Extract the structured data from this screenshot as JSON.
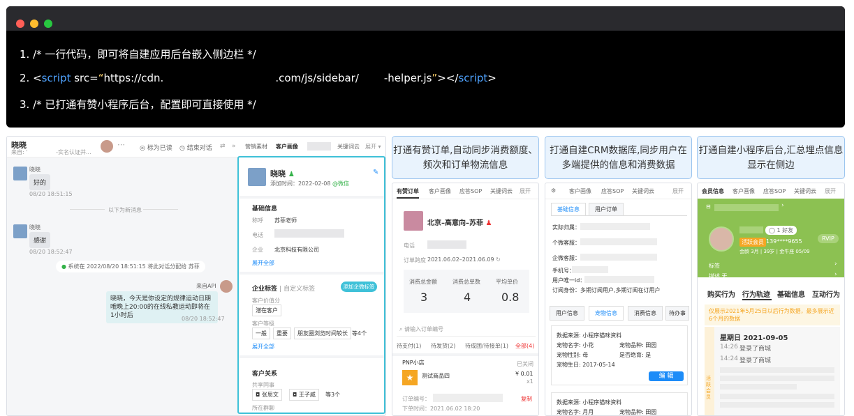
{
  "code": {
    "line1": "1. /* 一行代码，即可将自建应用后台嵌入侧边栏 */",
    "line2_prefix": "2. <",
    "line2_kw": "script",
    "line2_src": " src=",
    "line2_q1": "“",
    "line2_url1": "https://cdn.",
    "line2_url2": ".com/js/sidebar/",
    "line2_url3": "-helper.js",
    "line2_q2": "”",
    "line2_mid": "></",
    "line2_kw2": "script",
    "line2_end": ">",
    "line3": "3. /* 已打通有赞小程序后台，配置即可直接使用 */"
  },
  "chat": {
    "contact_name": "晓晓",
    "contact_sub": "来自: '                -实名认证并...",
    "mark_read": "标为已读",
    "end_chat": "结束对话",
    "msg1_name": "晓晓",
    "msg1_text": "好的",
    "msg1_time": "08/20 18:51:15",
    "divider": "以下为新消息",
    "msg2_name": "晓晓",
    "msg2_text": "感谢",
    "msg2_time": "08/20 18:52:47",
    "system": "系统在 2022/08/20 18:51:15 将此对话分配给 苏菲",
    "api_label": "来自API",
    "api_text": "晓晓，今天是你设定的规律运动日期哦晚上20:00的在线私教运动即将在1小时后",
    "api_time": "08/20 18:52:47"
  },
  "sidebar1": {
    "tabs": [
      "营销素材",
      "客户画像",
      "关键词云",
      "展开"
    ],
    "name": "晓晓",
    "added": "添加时间：2022-02-08",
    "wechat": "@微信",
    "basic_title": "基础信息",
    "nick_label": "称呼",
    "nick_value": "苏菲老师",
    "phone_label": "电话",
    "company_label": "企业",
    "company_value": "北京科技有限公司",
    "expand_all": "展开全部",
    "tags_title": "企业标签",
    "custom_tags": "自定义标签",
    "add_tag": "添加企微标签",
    "value_label": "客户价值分",
    "value_tag": "潜在客户",
    "level_label": "客户等级",
    "level_tags": [
      "一般",
      "重要",
      "朋友圈浏览时间较长"
    ],
    "level_more": "等4个",
    "expand_all2": "展开全部",
    "relation_title": "客户关系",
    "share_label": "共享同事",
    "share_people": [
      "张思文",
      "王子威"
    ],
    "share_more": "等3个",
    "group_label": "所在群聊"
  },
  "captions": [
    "打通有赞订单,自动同步消费额度、频次和订单物流信息",
    "打通自建CRM数据库,同步用户在多端提供的信息和消费数据",
    "打通自建小程序后台,汇总埋点信息显示在侧边"
  ],
  "orders": {
    "tabs": [
      "有赞订单",
      "客户画像",
      "应答SOP",
      "关键词云",
      "展开"
    ],
    "name": "北京–高意向–苏菲",
    "phone_label": "电话",
    "period_label": "订单跨度",
    "period_value": "2021.06.02–2021.06.09",
    "stat_labels": [
      "消费总金额",
      "消费总单数",
      "平均单价"
    ],
    "stat_values": [
      "3",
      "4",
      "0.8"
    ],
    "search_placeholder": "请输入订单编号",
    "filters": [
      "待支付(1)",
      "待发货(2)",
      "待成团/待接单(1)",
      "全部(4)"
    ],
    "shop": "PNP小店",
    "status": "已关闭",
    "product": "测试商品四",
    "price": "¥ 0.01",
    "qty": "x1",
    "order_no_label": "订单编号：",
    "copy": "复制",
    "order_time": "下单时间：2021.06.02 18:20"
  },
  "crm": {
    "tabs": [
      "客户画像",
      "应答SOP",
      "关键词云",
      "展开"
    ],
    "subtabs": [
      "基础信息",
      "用户订单"
    ],
    "fields": [
      "实际归属：",
      "个微客服：",
      "企微客服：",
      "手机号：",
      "用户唯一id：",
      "订阅身份：多期订阅用户,多期订阅在订用户"
    ],
    "tabs2": [
      "用户信息",
      "宠物信息",
      "消费信息",
      "待办事"
    ],
    "card1": [
      "数据来源: 小程序猫咪资料",
      "宠物名字: 小花",
      "宠物品种: 田园",
      "宠物性别: 母",
      "是否绝育: 是",
      "宠物生日: 2017-05-14"
    ],
    "edit": "编 辑",
    "card2": [
      "数据来源: 小程序猫咪资料",
      "宠物名字: 月月",
      "宠物品种: 田园"
    ]
  },
  "mini": {
    "tabs": [
      "会员信息",
      "客户画像",
      "应答SOP",
      "关键词云",
      "展开"
    ],
    "friend": "1 好友",
    "vip_label": "活跃会员",
    "phone": "139****9655",
    "member_info": "会龄 3月 | 39岁 | 金牛座 05/09",
    "rvip": "RVIP",
    "tag_label": "标签",
    "desc_label": "描述 无",
    "sections": [
      "购买行为",
      "行为轨迹",
      "基础信息",
      "互动行为"
    ],
    "notice": "仅展示2021年5月25日以后行为数据，最多展示近6个月的数据",
    "date": "星期日 2021-09-05",
    "events": [
      {
        "time": "14:26",
        "text": "登录了商城"
      },
      {
        "time": "14:24",
        "text": "登录了商城"
      }
    ],
    "side_label": "活跃会员"
  },
  "colors": {
    "accent": "#1d8cf8",
    "highlight": "#3fc1d8",
    "mini_green": "#8cc152"
  }
}
